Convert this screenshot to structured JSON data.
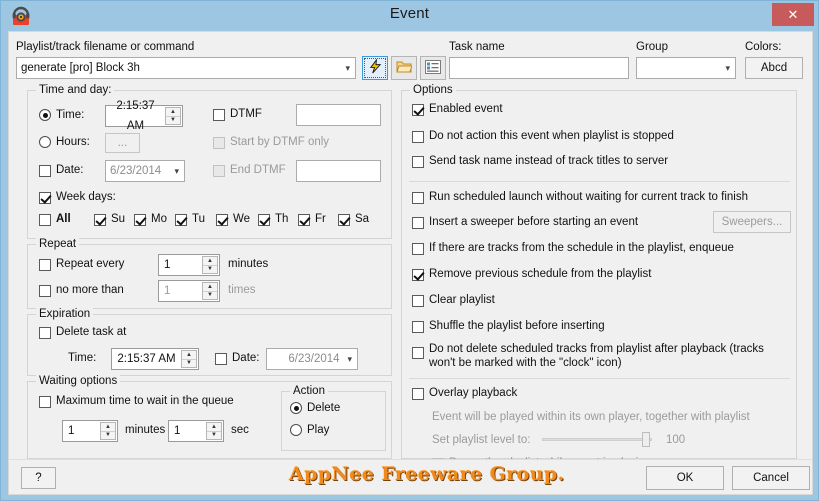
{
  "window": {
    "title": "Event",
    "icon": "radio-headphones-icon",
    "close_label": "✕",
    "titlebar_color": "#9dc6e3",
    "close_color": "#c75b5b"
  },
  "top": {
    "playlist_label": "Playlist/track filename or command",
    "playlist_value": "generate [pro] Block 3h",
    "task_name_label": "Task name",
    "task_name_value": "",
    "group_label": "Group",
    "group_value": "",
    "colors_label": "Colors:",
    "colors_button": "Abcd",
    "buttons": [
      {
        "name": "lightning-icon",
        "selected": true
      },
      {
        "name": "folder-open-icon",
        "selected": false
      },
      {
        "name": "list-icon",
        "selected": false
      }
    ]
  },
  "time_and_day": {
    "title": "Time and day:",
    "time_radio": "Time:",
    "time_selected": true,
    "time_value": "2:15:37 AM",
    "hours_radio": "Hours:",
    "hours_selected": false,
    "hours_button": "...",
    "date_checkbox": "Date:",
    "date_checked": false,
    "date_value": "6/23/2014",
    "dtmf_checkbox": "DTMF",
    "dtmf_checked": false,
    "dtmf_value": "",
    "start_by_dtmf": "Start by DTMF only",
    "start_by_dtmf_checked": false,
    "end_dtmf": "End DTMF",
    "end_dtmf_checked": false,
    "end_dtmf_value": "",
    "week_days_label": "Week days:",
    "week_days_checked": true,
    "all_label": "All",
    "all_checked": false,
    "days": [
      {
        "label": "Su",
        "checked": true
      },
      {
        "label": "Mo",
        "checked": true
      },
      {
        "label": "Tu",
        "checked": true
      },
      {
        "label": "We",
        "checked": true
      },
      {
        "label": "Th",
        "checked": true
      },
      {
        "label": "Fr",
        "checked": true
      },
      {
        "label": "Sa",
        "checked": true
      }
    ]
  },
  "repeat": {
    "title": "Repeat",
    "repeat_every_label": "Repeat every",
    "repeat_every_checked": false,
    "repeat_every_value": "1",
    "minutes_label": "minutes",
    "no_more_than_label": "no more than",
    "no_more_than_checked": false,
    "no_more_than_value": "1",
    "times_label": "times"
  },
  "expiration": {
    "title": "Expiration",
    "delete_task_label": "Delete task at",
    "delete_task_checked": false,
    "time_label": "Time:",
    "time_value": "2:15:37 AM",
    "date_label": "Date:",
    "date_checked": false,
    "date_value": "6/23/2014"
  },
  "waiting_options": {
    "title": "Waiting options",
    "max_wait_label": "Maximum time to wait in the queue",
    "max_wait_checked": false,
    "minutes_value": "1",
    "minutes_label": "minutes",
    "sec_value": "1",
    "sec_label": "sec",
    "action_title": "Action",
    "action_delete": "Delete",
    "action_play": "Play",
    "action_selected": "Delete"
  },
  "options": {
    "title": "Options",
    "items": [
      {
        "label": "Enabled event",
        "checked": true,
        "disabled": false
      },
      {
        "label": "Do not action this event when playlist is stopped",
        "checked": false,
        "disabled": false
      },
      {
        "label": "Send task name instead of track titles to server",
        "checked": false,
        "disabled": false
      },
      {
        "label": "Run scheduled launch without waiting for current track to finish",
        "checked": false,
        "disabled": false
      },
      {
        "label": "Insert a sweeper before starting an event",
        "checked": false,
        "disabled": false
      },
      {
        "label": "If there are tracks from the schedule in the playlist, enqueue",
        "checked": false,
        "disabled": false
      },
      {
        "label": "Remove previous schedule from the playlist",
        "checked": true,
        "disabled": false
      },
      {
        "label": "Clear playlist",
        "checked": false,
        "disabled": false
      },
      {
        "label": "Shuffle the playlist before inserting",
        "checked": false,
        "disabled": false
      },
      {
        "label": "Do not delete scheduled tracks from playlist after playback (tracks won't be marked with the \"clock\" icon)",
        "checked": false,
        "disabled": false
      }
    ],
    "sweepers_button": "Sweepers...",
    "overlay_label": "Overlay playback",
    "overlay_checked": false,
    "overlay_hint": "Event will be played within its own player, together with playlist",
    "level_label": "Set playlist level to:",
    "level_value": "100",
    "pause_label": "Pause the playlist while event is playing",
    "pause_checked": false
  },
  "footer": {
    "help_button": "?",
    "watermark": "AppNee Freeware Group.",
    "ok_button": "OK",
    "cancel_button": "Cancel"
  }
}
